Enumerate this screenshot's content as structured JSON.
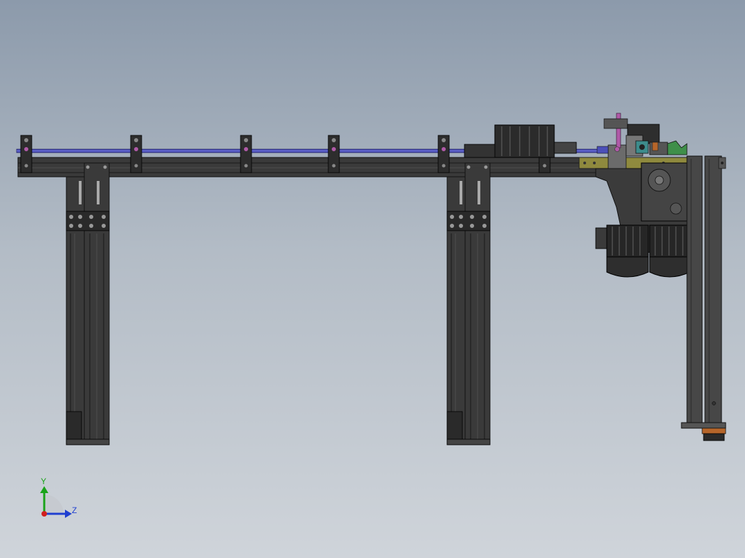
{
  "viewport": {
    "background_top": "#8c9aab",
    "background_bottom": "#cfd4da"
  },
  "model": {
    "frame_color": "#3a3a3a",
    "edge_color": "#111111",
    "rail_color": "#4b4fb8",
    "brass_color": "#8f8a3e",
    "accent_pink": "#b05aa8",
    "accent_green": "#3f8f4a",
    "accent_teal": "#3d8c8c",
    "accent_orange": "#b5652a"
  },
  "triad": {
    "y_label": "Y",
    "z_label": "Z",
    "y_color": "#19a319",
    "z_color": "#1f3fd0",
    "origin_color": "#d01f1f"
  }
}
